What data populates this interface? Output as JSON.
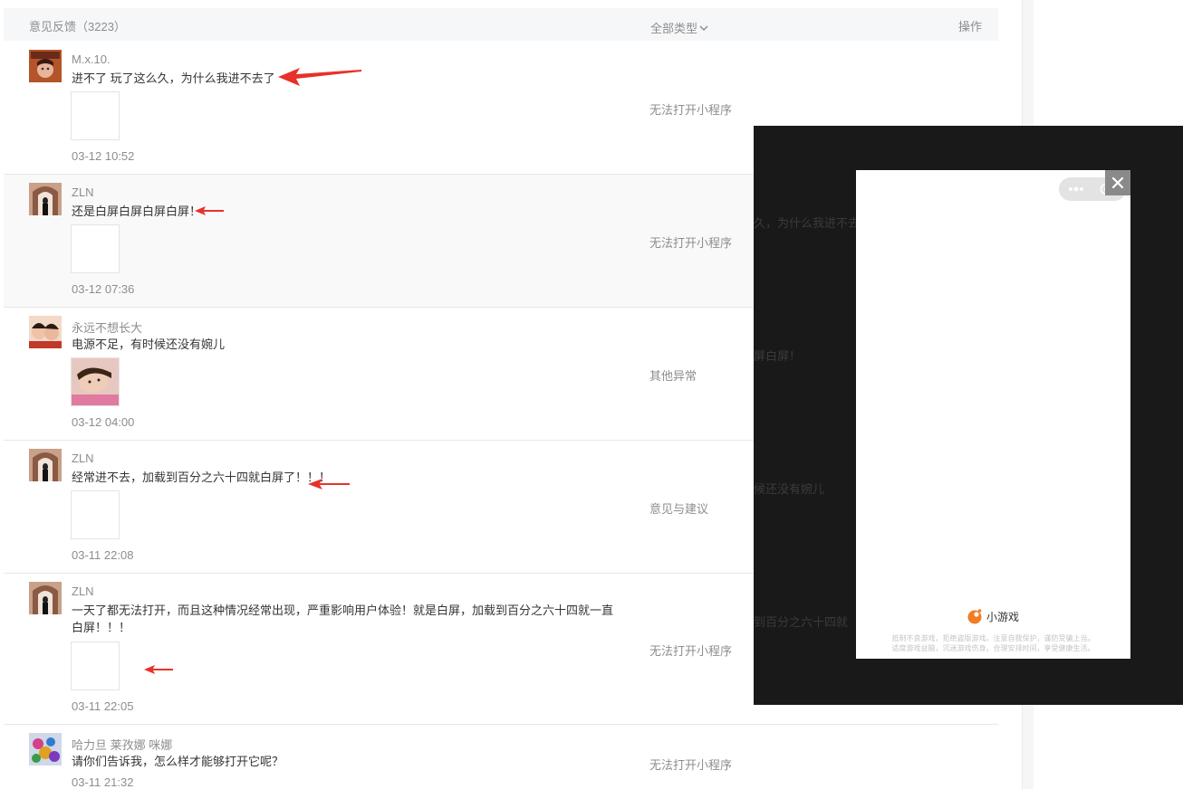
{
  "header": {
    "title": "意见反馈（3223）",
    "type_filter": "全部类型",
    "operation": "操作"
  },
  "feedback": [
    {
      "user": "M.x.10.",
      "text": "进不了 玩了这么久，为什么我进不去了",
      "date": "03-12 10:52",
      "type": "无法打开小程序",
      "has_arrow": true
    },
    {
      "user": "ZLN",
      "text": "还是白屏白屏白屏白屏！",
      "date": "03-12 07:36",
      "type": "无法打开小程序",
      "has_arrow": true
    },
    {
      "user": "永远不想长大",
      "text": "电源不足，有时候还没有婉儿",
      "date": "03-12 04:00",
      "type": "其他异常",
      "has_arrow": false
    },
    {
      "user": "ZLN",
      "text": "经常进不去，加载到百分之六十四就白屏了！！！",
      "date": "03-11 22:08",
      "type": "意见与建议",
      "has_arrow": true
    },
    {
      "user": "ZLN",
      "text": "一天了都无法打开，而且这种情况经常出现，严重影响用户体验！就是白屏，加载到百分之六十四就一直白屏！！！",
      "date": "03-11 22:05",
      "type": "无法打开小程序",
      "has_arrow": true
    },
    {
      "user": "哈力旦 莱孜娜 咪娜",
      "text": "请你们告诉我，怎么样才能够打开它呢？",
      "date": "03-11 21:32",
      "type": "无法打开小程序",
      "has_arrow": false
    }
  ],
  "overlay": {
    "ghost_texts": [
      "久，为什么我进不去",
      "屏白屏！",
      "候还没有婉儿",
      "到百分之六十四就"
    ],
    "brand": "小游戏",
    "notice_line1": "抵制不良游戏，拒绝盗版游戏。注意自我保护，谨防受骗上当。",
    "notice_line2": "适度游戏益脑，沉迷游戏伤身。合理安排时间，享受健康生活。"
  },
  "colors": {
    "arrow": "#e8312a",
    "overlay_bg": "#191919",
    "brand_orange": "#f27c21"
  }
}
